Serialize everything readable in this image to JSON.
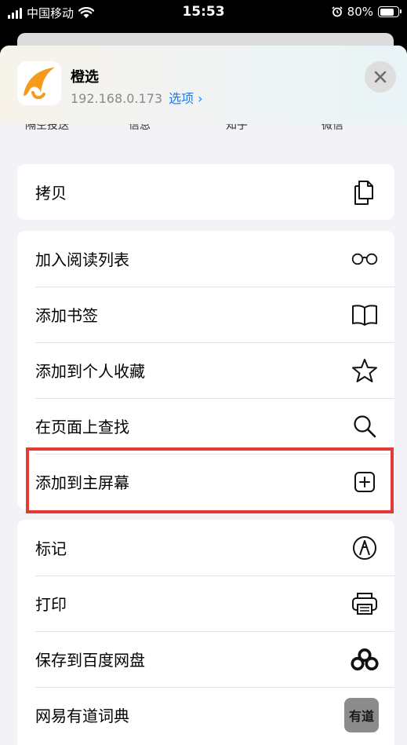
{
  "status_bar": {
    "carrier": "中国移动",
    "time": "15:53",
    "battery": "80%"
  },
  "header": {
    "app_name": "橙选",
    "address": "192.168.0.173",
    "options_label": "选项 ›"
  },
  "share_targets": [
    "隔空投送",
    "信息",
    "知乎",
    "微信"
  ],
  "groups": [
    {
      "items": [
        {
          "label": "拷贝",
          "icon": "copy-icon"
        }
      ]
    },
    {
      "items": [
        {
          "label": "加入阅读列表",
          "icon": "reading-glasses-icon"
        },
        {
          "label": "添加书签",
          "icon": "book-icon"
        },
        {
          "label": "添加到个人收藏",
          "icon": "star-icon"
        },
        {
          "label": "在页面上查找",
          "icon": "search-icon"
        },
        {
          "label": "添加到主屏幕",
          "icon": "plus-square-icon"
        }
      ]
    },
    {
      "items": [
        {
          "label": "标记",
          "icon": "markup-pen-icon"
        },
        {
          "label": "打印",
          "icon": "printer-icon"
        },
        {
          "label": "保存到百度网盘",
          "icon": "baidu-cloud-icon"
        },
        {
          "label": "网易有道词典",
          "icon": "youdao-icon",
          "icon_text": "有道"
        }
      ]
    }
  ]
}
